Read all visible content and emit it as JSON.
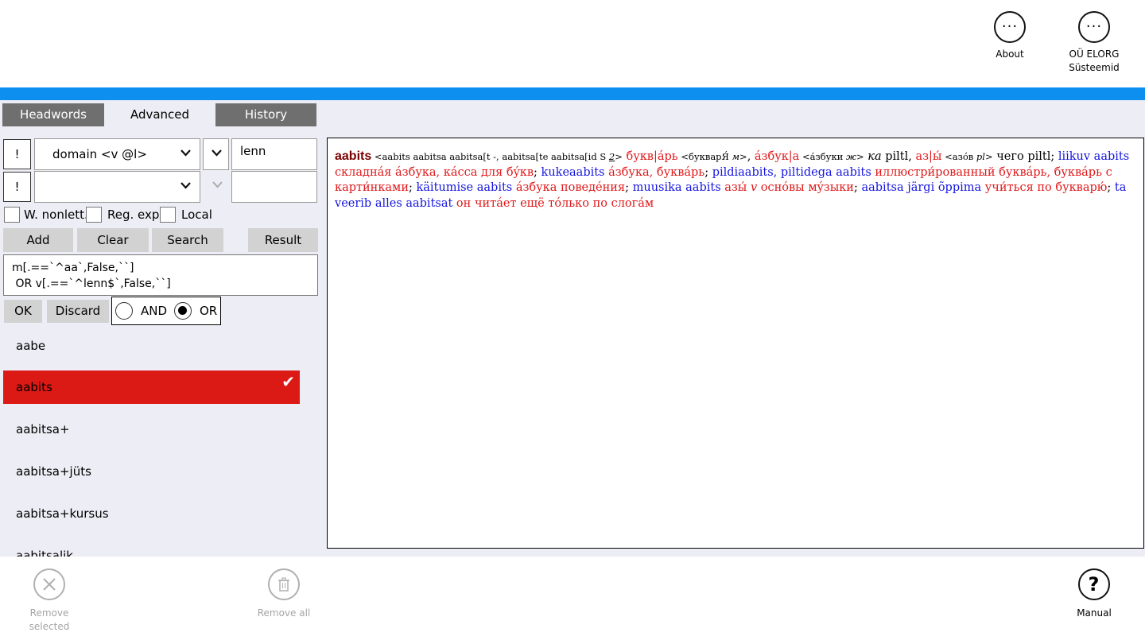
{
  "appbar_top": {
    "about_label": "About",
    "company_label_1": "OÜ ELORG",
    "company_label_2": "Süsteemid"
  },
  "tabs": {
    "headwords": "Headwords",
    "advanced": "Advanced",
    "history": "History"
  },
  "filter": {
    "row1": {
      "not_label": "!",
      "field_value": "domain <v @l>",
      "text_value": "lenn"
    },
    "row2": {
      "not_label": "!",
      "field_value": "",
      "text_value": ""
    }
  },
  "options": {
    "w_nonlett": "W. nonlett.",
    "reg_exp": "Reg. exp.",
    "local": "Local"
  },
  "buttons": {
    "add": "Add",
    "clear": "Clear",
    "search": "Search",
    "result": "Result",
    "ok": "OK",
    "discard": "Discard"
  },
  "query": {
    "line1": "m[.==`^aa`,False,``]",
    "line2": " OR v[.==`^lenn$`,False,``]"
  },
  "logic": {
    "and_label": "AND",
    "or_label": "OR",
    "selected": "OR"
  },
  "wordlist": [
    "aabe",
    "aabits",
    "aabitsa+",
    "aabitsa+jüts",
    "aabitsa+kursus",
    "aabitsalik"
  ],
  "selected_word": "aabits",
  "article": {
    "headword": "aabits",
    "gram": " <aabits aabitsa aabitsa[t -, aabitsa[te aabitsa[id S ",
    "gram_num": "2",
    "gram_end": ">",
    "t1": " букв|áрь",
    "g1": " <букварЯ́ ",
    "g1_it": "м",
    "g1_end": ">",
    "sep1": ", ",
    "t2": "áзбук|а",
    "g2": " <áзбуки ",
    "g2_it": "ж",
    "g2_end": ">",
    "ka": " ка",
    "piltl1": " piltl, ",
    "t3": "аз|ы́",
    "g3": " <азóв ",
    "g3_it": "pl",
    "g3_end": ">",
    "chego": " чего ",
    "piltl2": "piltl; ",
    "liikuv": "liikuv aabits",
    "t4": " складнáя áзбука, кáсса для бýкв",
    "semi1": "; ",
    "kukeaabits": "kukeaabits",
    "t5": " áзбука, буквáрь",
    "semi2": "; ",
    "pildiaabits": "pildiaabits, piltidega aabits",
    "t6": " иллюстри́рованный буквáрь, буквáрь с карти́нками",
    "semi3": "; ",
    "kaitumise": "käitumise aabits",
    "t7": " áзбука поведéния",
    "semi4": "; ",
    "muusika": "muusika aabits",
    "t8a": " азы́ ",
    "t8v": "v",
    "t8b": " оснóвы мýзыки",
    "semi5": "; ",
    "jargi": "aabitsa järgi õppima",
    "t9": " учи́ться по букварю́",
    "semi6": "; ",
    "veerib": "ta veerib alles aabitsat",
    "t10": " он читáет ещё тóлько по слогáм"
  },
  "appbar_bottom": {
    "remove_selected_1": "Remove",
    "remove_selected_2": "selected",
    "remove_all": "Remove all",
    "manual": "Manual"
  },
  "colors": {
    "accent": "#0d8fef",
    "selected_row": "#dc1a15",
    "tab_inactive": "#6f6f70",
    "headword": "#7a0000",
    "translation": "#e0181a",
    "phrase": "#1515e0"
  }
}
